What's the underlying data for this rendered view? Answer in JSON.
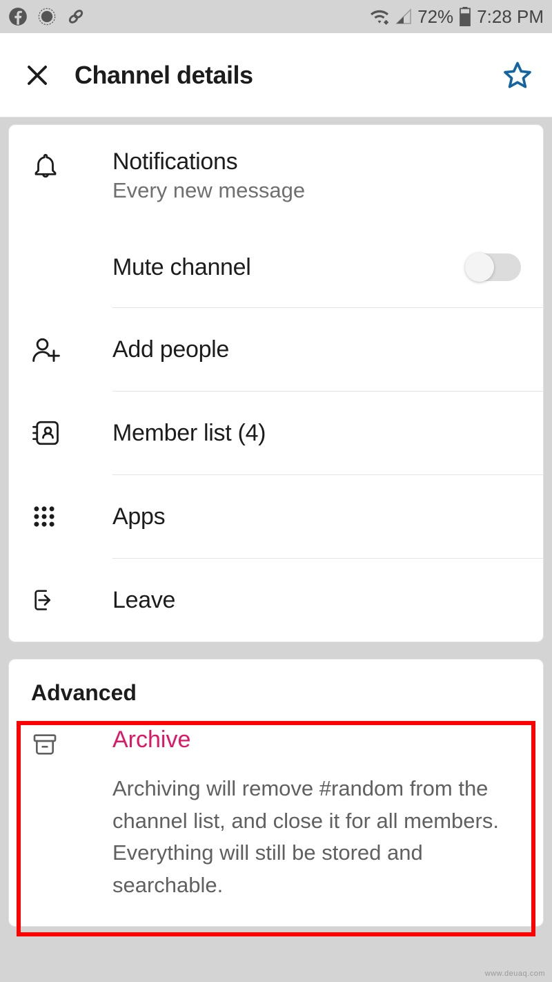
{
  "status_bar": {
    "battery_percent": "72%",
    "time": "7:28 PM"
  },
  "header": {
    "title": "Channel details"
  },
  "settings_card": {
    "notifications": {
      "title": "Notifications",
      "subtitle": "Every new message"
    },
    "mute": {
      "title": "Mute channel",
      "on": false
    },
    "add_people": "Add people",
    "member_list": "Member list (4)",
    "apps": "Apps",
    "leave": "Leave"
  },
  "advanced_card": {
    "header": "Advanced",
    "archive": {
      "title": "Archive",
      "description": "Archiving will remove #random from the channel list, and close it for all members. Everything will still be stored and searchable."
    }
  },
  "watermark": "www.deuaq.com"
}
